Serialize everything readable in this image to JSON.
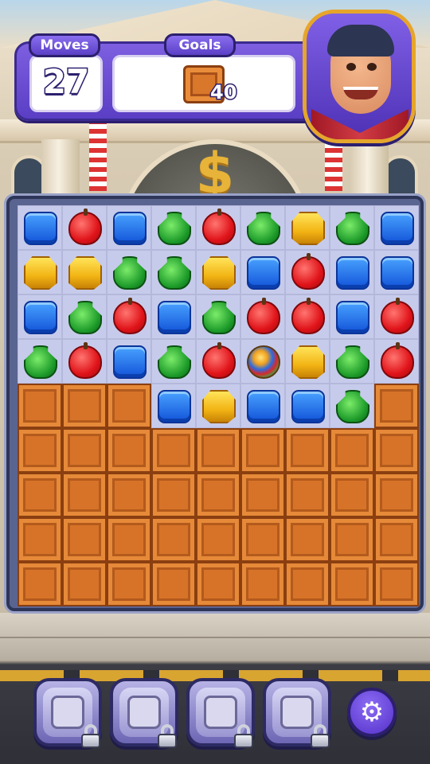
{
  "hud": {
    "moves_label": "Moves",
    "moves_value": "27",
    "goals_label": "Goals",
    "goal_item": "crate-icon",
    "goal_count": "40"
  },
  "character": "mayor-portrait",
  "board": {
    "columns": 9,
    "rows": 9,
    "cells": [
      [
        "blue",
        "red",
        "blue",
        "green",
        "red",
        "green",
        "yellow",
        "green",
        "blue"
      ],
      [
        "yellow",
        "yellow",
        "green",
        "green",
        "yellow",
        "blue",
        "red",
        "blue",
        "blue"
      ],
      [
        "blue",
        "green",
        "red",
        "blue",
        "green",
        "red",
        "red",
        "blue",
        "red"
      ],
      [
        "green",
        "red",
        "blue",
        "green",
        "red",
        "ball",
        "yellow",
        "green",
        "red"
      ],
      [
        "crate",
        "crate",
        "crate",
        "blue",
        "yellow",
        "blue",
        "blue",
        "green",
        "crate"
      ],
      [
        "crate",
        "crate",
        "crate",
        "crate",
        "crate",
        "crate",
        "crate",
        "crate",
        "crate"
      ],
      [
        "crate",
        "crate",
        "crate",
        "crate",
        "crate",
        "crate",
        "crate",
        "crate",
        "crate"
      ],
      [
        "crate",
        "crate",
        "crate",
        "crate",
        "crate",
        "crate",
        "crate",
        "crate",
        "crate"
      ],
      [
        "crate",
        "crate",
        "crate",
        "crate",
        "crate",
        "crate",
        "crate",
        "crate",
        "crate"
      ]
    ]
  },
  "boosters": [
    {
      "icon": "hammer-icon",
      "locked": true
    },
    {
      "icon": "cannon-icon",
      "locked": true
    },
    {
      "icon": "robot-icon",
      "locked": true
    },
    {
      "icon": "shield-book-icon",
      "locked": true
    }
  ],
  "settings_icon": "gear-icon",
  "colors": {
    "hud_purple": "#5a3ec4",
    "gold": "#e6a52b",
    "crate": "#d77328"
  }
}
